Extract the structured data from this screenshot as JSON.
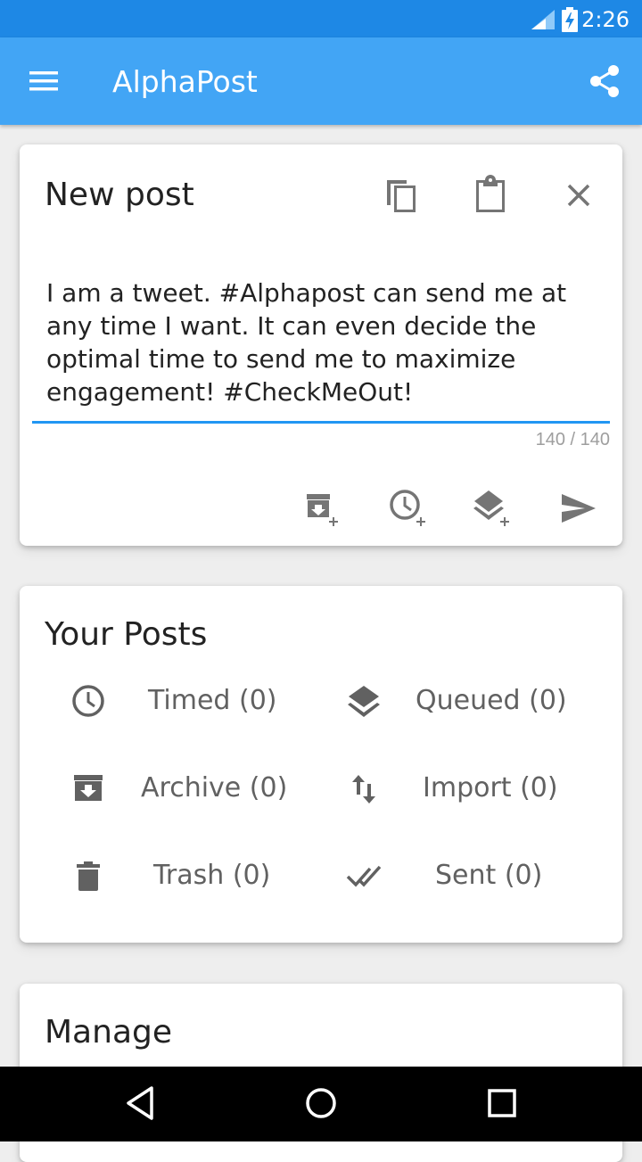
{
  "status_bar": {
    "time": "2:26"
  },
  "app_bar": {
    "title": "AlphaPost"
  },
  "new_post": {
    "title": "New post",
    "text": "I am a tweet. #Alphapost can send me at any time I want. It can even decide the optimal time to send me to maximize engagement! #CheckMeOut!",
    "char_count": "140 / 140"
  },
  "your_posts": {
    "title": "Your Posts",
    "items": [
      {
        "label": "Timed (0)",
        "icon": "clock-icon"
      },
      {
        "label": "Queued (0)",
        "icon": "layers-icon"
      },
      {
        "label": "Archive (0)",
        "icon": "archive-icon"
      },
      {
        "label": "Import (0)",
        "icon": "import-arrows-icon"
      },
      {
        "label": "Trash (0)",
        "icon": "trash-icon"
      },
      {
        "label": "Sent (0)",
        "icon": "double-check-icon"
      }
    ]
  },
  "manage": {
    "title": "Manage"
  },
  "colors": {
    "status_bar": "#1e88e5",
    "app_bar": "#42a5f5",
    "accent": "#2196f3",
    "icon_gray": "#616161"
  }
}
